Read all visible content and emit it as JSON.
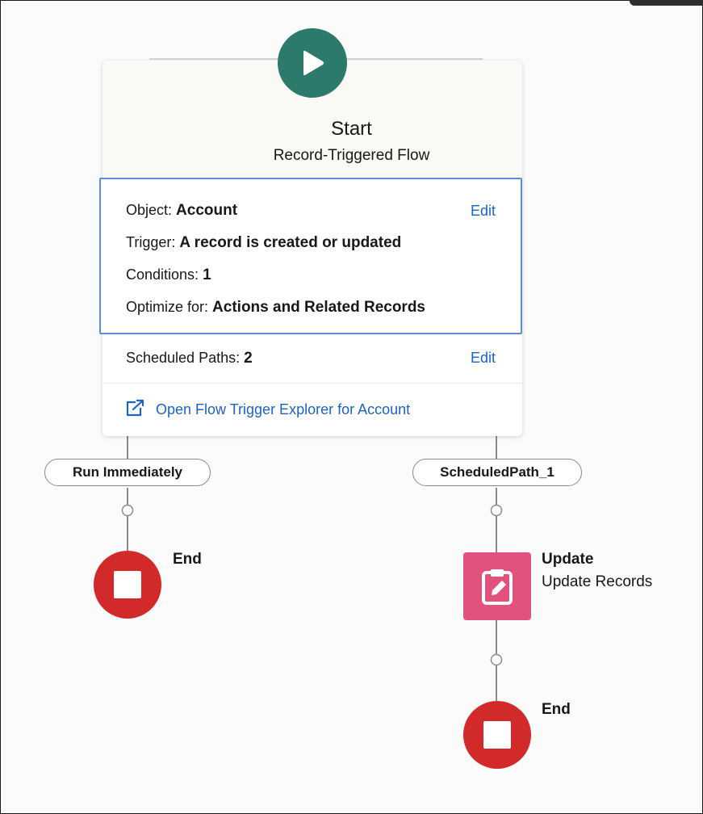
{
  "start": {
    "title": "Start",
    "subtitle": "Record-Triggered Flow",
    "icon": "play-icon",
    "accent_color": "#2b7a6b"
  },
  "trigger_details": {
    "object_label": "Object:",
    "object_value": "Account",
    "trigger_label": "Trigger:",
    "trigger_value": "A record is created or updated",
    "conditions_label": "Conditions:",
    "conditions_value": "1",
    "optimize_label": "Optimize for:",
    "optimize_value": "Actions and Related Records",
    "edit_label": "Edit"
  },
  "scheduled": {
    "label": "Scheduled Paths:",
    "value": "2",
    "edit_label": "Edit"
  },
  "explorer_link": {
    "label": "Open Flow Trigger Explorer for Account",
    "icon": "external-link-icon"
  },
  "paths": [
    {
      "label": "Run Immediately"
    },
    {
      "label": "ScheduledPath_1"
    }
  ],
  "nodes": {
    "end_left": {
      "label": "End",
      "icon": "stop-icon",
      "color": "#d22a2b"
    },
    "update": {
      "label": "Update",
      "sublabel": "Update Records",
      "icon": "clipboard-edit-icon",
      "color": "#e3517d"
    },
    "end_right": {
      "label": "End",
      "icon": "stop-icon",
      "color": "#d22a2b"
    }
  }
}
